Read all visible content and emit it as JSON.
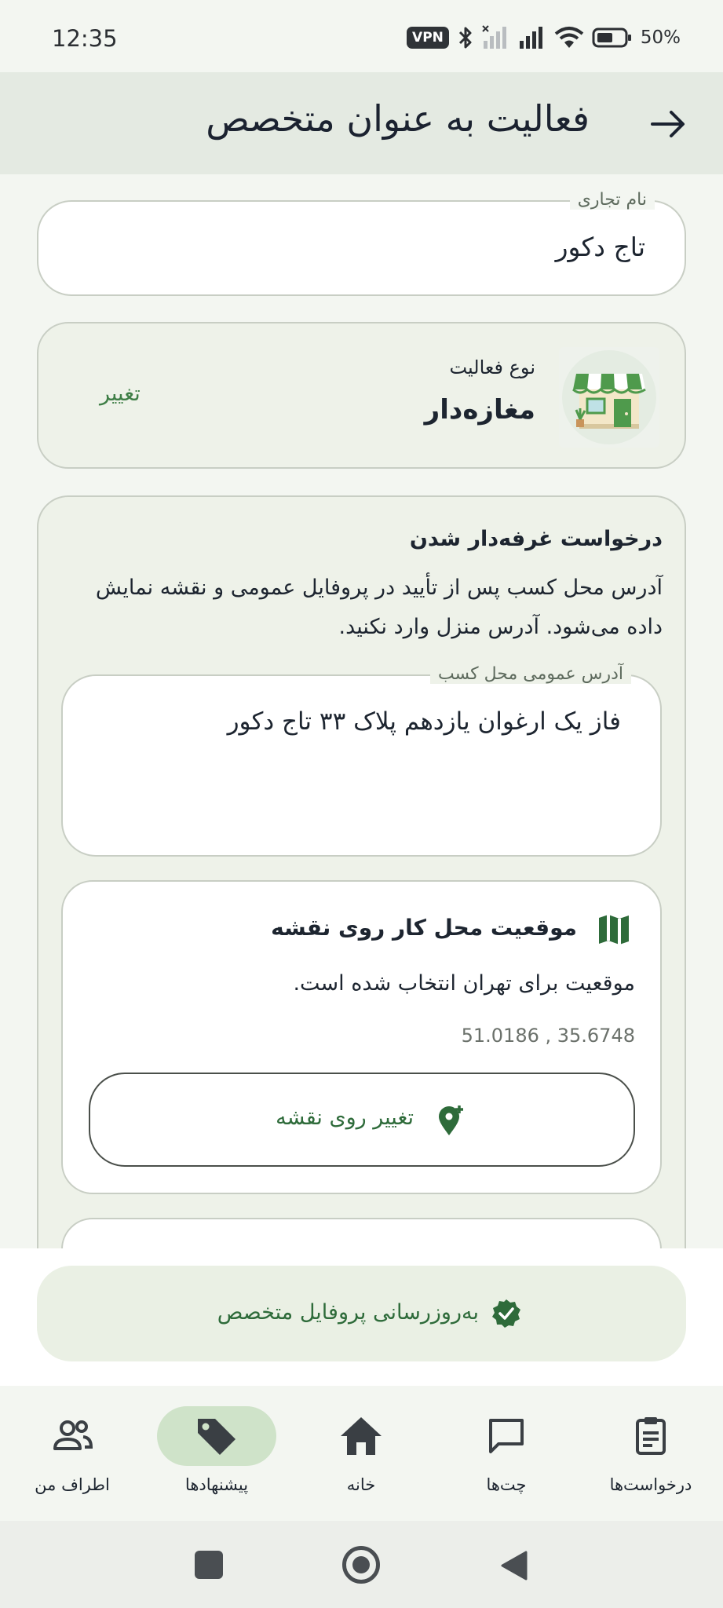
{
  "status_bar": {
    "time": "12:35",
    "vpn": "VPN",
    "battery": "50%"
  },
  "app_bar": {
    "title": "فعالیت به عنوان متخصص",
    "back_icon": "arrow-right-icon"
  },
  "business_name": {
    "label": "نام تجاری",
    "value": "تاج دکور"
  },
  "activity_type": {
    "label": "نوع فعالیت",
    "value": "مغازه‌دار",
    "change_label": "تغییر",
    "icon": "shop-icon"
  },
  "booth_request": {
    "title": "درخواست غرفه‌دار شدن",
    "description_line1": "آدرس محل کسب پس از تأیید در پروفایل عمومی و نقشه نمایش",
    "description_line2": "داده می‌شود. آدرس منزل وارد نکنید.",
    "address_label": "آدرس عمومی محل کسب",
    "address_value": "فاز یک ارغوان یازدهم پلاک ۳۳ تاج دکور"
  },
  "location": {
    "title": "موقعیت محل کار روی نقشه",
    "description": "موقعیت برای تهران انتخاب شده است.",
    "coordinates": "51.0186 , 35.6748",
    "change_button": "تغییر روی نقشه",
    "map_icon": "map-icon",
    "pin_icon": "add-location-icon"
  },
  "update_button": {
    "label": "به‌روزرسانی پروفایل متخصص",
    "icon": "verified-badge-icon"
  },
  "bottom_nav": {
    "items": [
      {
        "label": "درخواست‌ها",
        "icon": "clipboard-icon"
      },
      {
        "label": "چت‌ها",
        "icon": "chat-icon"
      },
      {
        "label": "خانه",
        "icon": "home-icon"
      },
      {
        "label": "پیشنهادها",
        "icon": "tag-icon"
      },
      {
        "label": "اطراف من",
        "icon": "people-icon"
      }
    ],
    "active_index": 3
  },
  "colors": {
    "accent_green": "#2e6b3a",
    "pill_active": "#cfe3c9",
    "card_bg": "#eef2e9"
  }
}
